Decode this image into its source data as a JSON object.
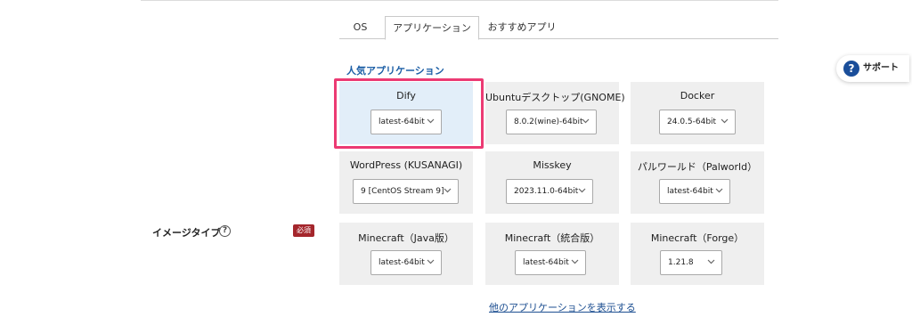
{
  "tabs": [
    {
      "label": "OS"
    },
    {
      "label": "アプリケーション",
      "active": true
    },
    {
      "label": "おすすめアプリ"
    }
  ],
  "section_title": "人気アプリケーション",
  "cards": [
    {
      "name": "Dify",
      "version": "latest-64bit",
      "selected": true
    },
    {
      "name": "Ubuntuデスクトップ(GNOME)",
      "version": "8.0.2(wine)-64bit"
    },
    {
      "name": "Docker",
      "version": "24.0.5-64bit"
    },
    {
      "name": "WordPress (KUSANAGI)",
      "version": "9 [CentOS Stream 9]"
    },
    {
      "name": "Misskey",
      "version": "2023.11.0-64bit"
    },
    {
      "name": "パルワールド（Palworld）",
      "version": "latest-64bit"
    },
    {
      "name": "Minecraft（Java版）",
      "version": "latest-64bit"
    },
    {
      "name": "Minecraft（統合版）",
      "version": "latest-64bit"
    },
    {
      "name": "Minecraft（Forge）",
      "version": "1.21.8"
    }
  ],
  "image_type": {
    "label": "イメージタイプ",
    "help_glyph": "?",
    "required": "必須"
  },
  "more_link": "他のアプリケーションを表示する",
  "support": {
    "label": "サポート",
    "icon_glyph": "?"
  },
  "colors": {
    "accent_link": "#1d5fa6",
    "selected_card": "#e2eef9",
    "highlight_border": "#ec3a73",
    "required_badge": "#a4262c",
    "support_icon": "#1a4e9a"
  }
}
